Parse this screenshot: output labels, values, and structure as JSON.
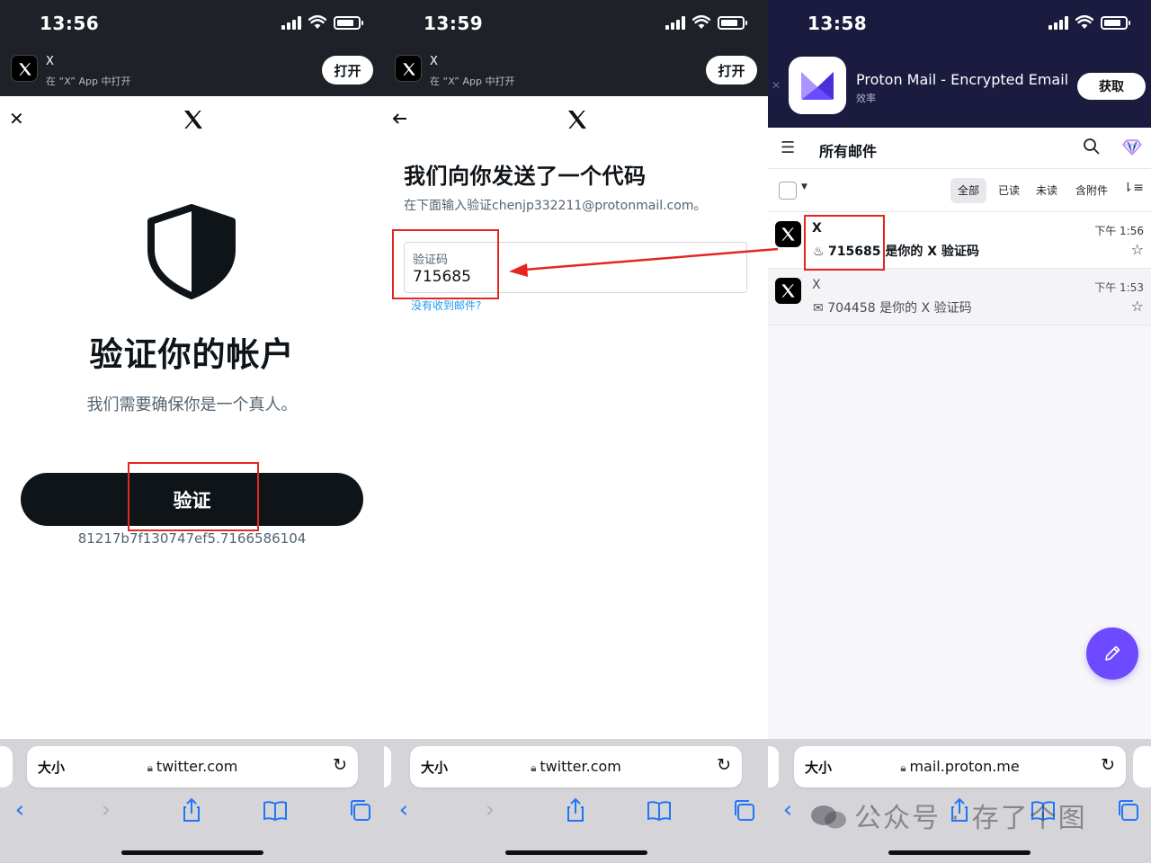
{
  "panel1": {
    "status_time": "13:56",
    "banner": {
      "app_name": "X",
      "subtitle": "在 “X” App 中打开",
      "open_label": "打开"
    },
    "title": "验证你的帐户",
    "subtitle": "我们需要确保你是一个真人。",
    "verify_label": "验证",
    "hash": "81217b7f130747ef5.7166586104",
    "url": "twitter.com",
    "aa_label": "大小"
  },
  "panel2": {
    "status_time": "13:59",
    "banner": {
      "app_name": "X",
      "subtitle": "在 “X” App 中打开",
      "open_label": "打开"
    },
    "title": "我们向你发送了一个代码",
    "subtitle": "在下面输入验证chenjp332211@protonmail.com。",
    "code_label": "验证码",
    "code_value": "715685",
    "no_mail_link": "没有收到邮件?",
    "url": "twitter.com",
    "aa_label": "大小"
  },
  "panel3": {
    "status_time": "13:58",
    "banner": {
      "app_name": "Proton Mail - Encrypted Email",
      "category": "效率",
      "get_label": "获取"
    },
    "mailbox_title": "所有邮件",
    "filters": [
      "全部",
      "已读",
      "未读",
      "含附件"
    ],
    "active_filter": "全部",
    "messages": [
      {
        "from": "X",
        "subject": "715685 是你的 X 验证码",
        "time": "下午 1:56",
        "unread": true
      },
      {
        "from": "X",
        "subject": "704458 是你的 X 验证码",
        "time": "下午 1:53",
        "unread": false
      }
    ],
    "url": "mail.proton.me",
    "aa_label": "大小",
    "watermark": "公众号 · 存了个图"
  },
  "colors": {
    "annotation_red": "#e52620",
    "x_dark": "#0f1419",
    "proton_purple": "#6d4aff",
    "proton_banner": "#1b1b3f",
    "safari_blue": "#2276f5",
    "link_blue": "#1d9bf0"
  },
  "icons": [
    "x-logo-icon",
    "close-icon",
    "back-arrow-icon",
    "shield-icon",
    "lock-icon",
    "reload-icon",
    "share-icon",
    "bookmarks-icon",
    "tabs-icon",
    "menu-icon",
    "search-icon",
    "gem-icon",
    "star-icon",
    "pencil-icon",
    "proton-logo-icon",
    "fire-icon",
    "envelope-open-icon"
  ]
}
